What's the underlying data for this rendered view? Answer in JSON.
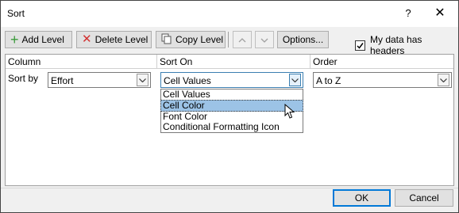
{
  "window": {
    "title": "Sort",
    "help": "?",
    "close": "✕"
  },
  "toolbar": {
    "add_level": "Add Level",
    "delete_level": "Delete Level",
    "copy_level": "Copy Level",
    "options": "Options...",
    "my_data_has_headers": "My data has headers",
    "headers_checked": true
  },
  "columns": {
    "column": "Column",
    "sort_on": "Sort On",
    "order": "Order"
  },
  "row": {
    "label": "Sort by",
    "column_value": "Effort",
    "sort_on_value": "Cell Values",
    "order_value": "A to Z"
  },
  "dropdown": {
    "options": [
      "Cell Values",
      "Cell Color",
      "Font Color",
      "Conditional Formatting Icon"
    ],
    "highlighted": "Cell Color"
  },
  "footer": {
    "ok": "OK",
    "cancel": "Cancel"
  },
  "colors": {
    "add_icon": "#3a9a3a",
    "delete_icon": "#d23030",
    "highlight": "#9cc3e6",
    "focus": "#0078d7"
  }
}
